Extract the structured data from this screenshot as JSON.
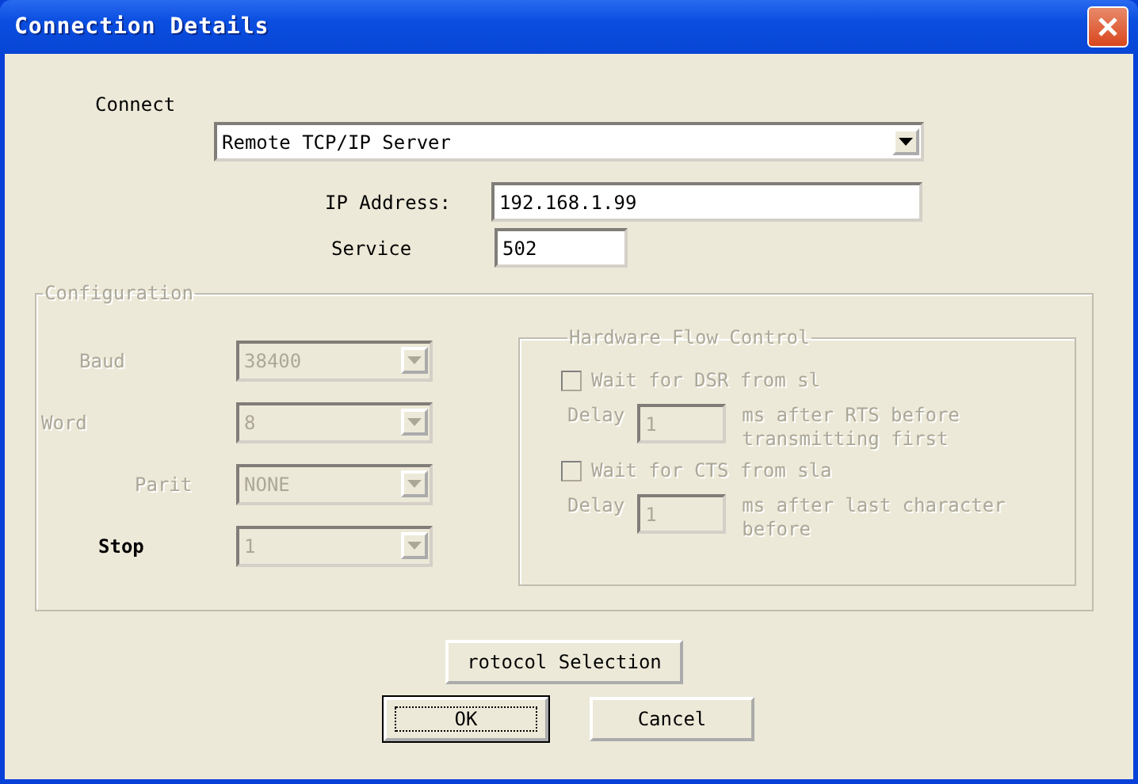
{
  "window": {
    "title": "Connection Details"
  },
  "connect": {
    "label": "Connect",
    "value": "Remote TCP/IP Server"
  },
  "ip_address": {
    "label": "IP Address:",
    "value": "192.168.1.99"
  },
  "service": {
    "label": "Service",
    "value": "502"
  },
  "configuration": {
    "title": "Configuration",
    "fields": [
      {
        "label": "Baud",
        "value": "38400",
        "label_disabled": true,
        "disabled": true
      },
      {
        "label": "Word",
        "value": "8",
        "label_disabled": true,
        "disabled": true
      },
      {
        "label": "Parit",
        "value": "NONE",
        "label_disabled": true,
        "disabled": true
      },
      {
        "label": "Stop",
        "value": "1",
        "label_disabled": false,
        "disabled": true
      }
    ],
    "hardware_flow_control": {
      "title": "Hardware Flow Control",
      "items": [
        {
          "label": "Wait for DSR from sl",
          "checked": false,
          "disabled": true,
          "delay_label": "Delay",
          "delay_value": "1",
          "note": "ms after RTS before transmitting first"
        },
        {
          "label": "Wait for CTS from sla",
          "checked": false,
          "disabled": true,
          "delay_label": "Delay",
          "delay_value": "1",
          "note": "ms after last character before"
        }
      ]
    }
  },
  "protocol_button": {
    "label": "rotocol Selection"
  },
  "buttons": [
    {
      "label": "OK",
      "focused": true
    },
    {
      "label": "Cancel",
      "focused": false
    }
  ]
}
